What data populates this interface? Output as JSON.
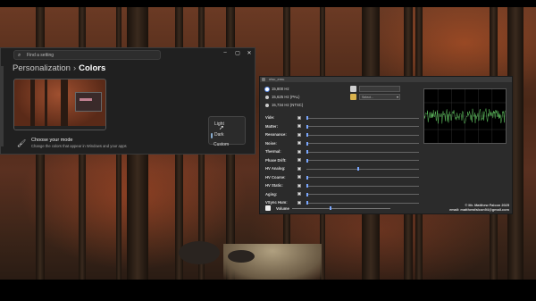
{
  "settings": {
    "search_placeholder": "Find a setting",
    "breadcrumb_parent": "Personalization",
    "breadcrumb_separator": "›",
    "breadcrumb_current": "Colors",
    "window_buttons": {
      "minimize": "–",
      "maximize": "▢",
      "close": "✕"
    },
    "mode": {
      "title": "Choose your mode",
      "description": "Change the colors that appear in Windows and your apps"
    },
    "mode_dropdown": {
      "options": [
        "Light",
        "Dark"
      ],
      "selected": "Dark"
    },
    "custom_label": "Custom",
    "icons": [
      "search-icon",
      "brush-icon",
      "cursor-icon"
    ]
  },
  "ntsc": {
    "window_title": "ntsc_emu",
    "radio_options": [
      {
        "label": "15,800 Hz",
        "selected": true
      },
      {
        "label": "15,625 Hz (PAL)",
        "selected": false
      },
      {
        "label": "15,734 Hz (NTSC)",
        "selected": false
      }
    ],
    "combo_value": "Select...",
    "params": [
      {
        "label": "Vide:",
        "level": 0.0
      },
      {
        "label": "Matter:",
        "level": 0.0
      },
      {
        "label": "Resonance:",
        "level": 0.0
      },
      {
        "label": "Noise:",
        "level": 0.0
      },
      {
        "label": "Thermal:",
        "level": 0.0
      },
      {
        "label": "Phase Drift:",
        "level": 0.0
      },
      {
        "label": "HV Analog:",
        "level": 0.45
      },
      {
        "label": "HV Coarse:",
        "level": 0.0
      },
      {
        "label": "HV Static:",
        "level": 0.0
      },
      {
        "label": "Aging:",
        "level": 0.0
      },
      {
        "label": "VSync Hum:",
        "level": 0.0
      }
    ],
    "volume_label": "Volume",
    "volume_level": 0.38,
    "credit_line1": "© Mr. Matthew Falcon 2025",
    "credit_line2": "email: matthewfalcon94@gmail.com",
    "scope_color": "#5fbf5f"
  }
}
